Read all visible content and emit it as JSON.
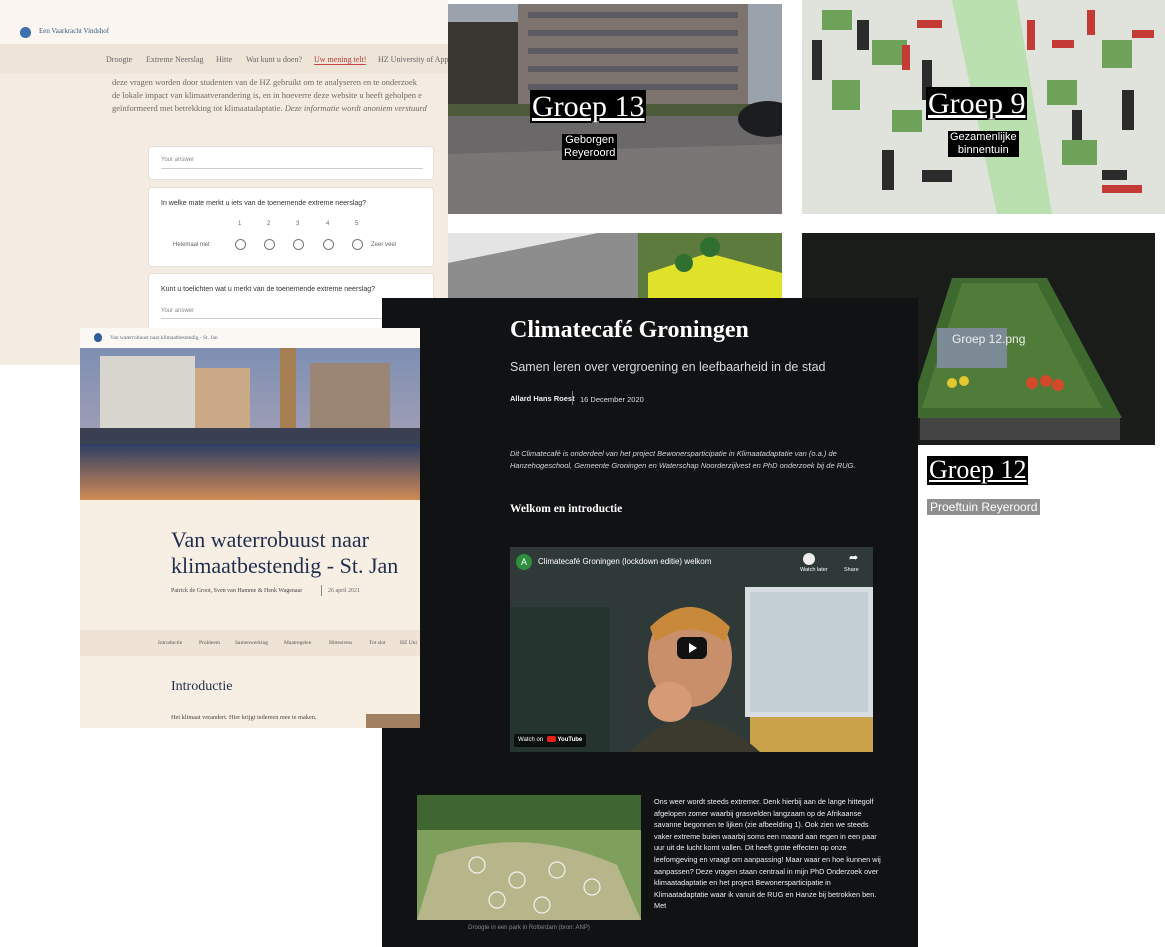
{
  "survey": {
    "brand": "Een Vaarkracht Vindshof",
    "nav": [
      "Droogte",
      "Extreme Neerslag",
      "Hitte",
      "Wat kunt u doen?",
      "Uw mening telt!",
      "HZ University of App"
    ],
    "nav_active": "Uw mening telt!",
    "intro_line1": "deze vragen worden door studenten van de HZ gebruikt om te analyseren en te onderzoek",
    "intro_line2": "de lokale impact van klimaatverandering is, en in hoeverre deze website u heeft geholpen e",
    "intro_line3a": "geïnformeerd met betrekking tot klimaatadaptatie.",
    "intro_line3b": "Deze informatie wordt anoniem verstuurd",
    "answer_placeholder": "Your answer",
    "q1": "In welke mate merkt u iets van de toenemende extreme neerslag?",
    "scale": [
      "1",
      "2",
      "3",
      "4",
      "5"
    ],
    "scale_min": "Helemaal niet",
    "scale_max": "Zeer veel",
    "q2": "Kunt u toelichten wat u merkt van de toenemende extreme neerslag?"
  },
  "groep13": {
    "title": "Groep 13",
    "sub1": "Geborgen",
    "sub2": "Reyeroord"
  },
  "groep9": {
    "title": "Groep 9",
    "sub1": "Gezamenlijke",
    "sub2": "binnentuin"
  },
  "groep12": {
    "image_label": "Groep 12.png",
    "title": "Groep 12",
    "sub": "Proeftuin Reyeroord"
  },
  "blog": {
    "title": "Climatecafé Groningen",
    "subtitle": "Samen leren over vergroening en leefbaarheid in de stad",
    "author": "Allard Hans Roest",
    "date": "16 December 2020",
    "lead": "Dit Climatecafé is onderdeel van het project Bewonersparticipatie in Klimaatadaptatie van (o.a.) de Hanzehogeschool, Gemeente Groningen en Waterschap Noorderzijlvest en PhD onderzoek bij de RUG.",
    "heading": "Welkom en introductie",
    "video": {
      "channel_initial": "A",
      "title": "Climatecafé Groningen (lockdown editie) welkom",
      "watch_later": "Watch later",
      "share": "Share",
      "watch_on": "Watch on",
      "youtube": "YouTube"
    },
    "photo_caption": "Droogte in een park in Rotterdam (bron: ANP)",
    "body": "Ons weer wordt steeds extremer. Denk hierbij aan de lange hittegolf afgelopen zomer waarbij grasvelden langzaam op de Afrikaanse savanne begonnen te lijken (zie afbeelding 1). Ook zien we steeds vaker extreme buien waarbij soms een maand aan regen in een paar uur uit de lucht komt vallen. Dit heeft grote effecten op onze leefomgeving en vraagt om aanpassing! Maar waar en hoe kunnen wij aanpassen? Deze vragen staan centraal in mijn PhD Onderzoek over klimaatadaptatie en het project Bewonersparticipatie in Klimaatadaptatie waar ik vanuit de RUG en Hanze bij betrokken ben. Met"
  },
  "stjan": {
    "crumb": "Van waterrobuust naar klimaatbestendig - St. Jan",
    "title": "Van waterrobuust naar klimaatbestendig - St. Jan",
    "authors": "Patrick de Groot, Sven van Hamme & Henk Wagenaar",
    "date": "26 april 2021",
    "nav": [
      "Introductie",
      "Probleem",
      "Samenwerking",
      "Maatregelen",
      "Hittestress",
      "Tot slot",
      "HZ Uni"
    ],
    "section": "Introductie",
    "para": "Het klimaat verandert. Hier krijgt iedereen mee te maken."
  }
}
